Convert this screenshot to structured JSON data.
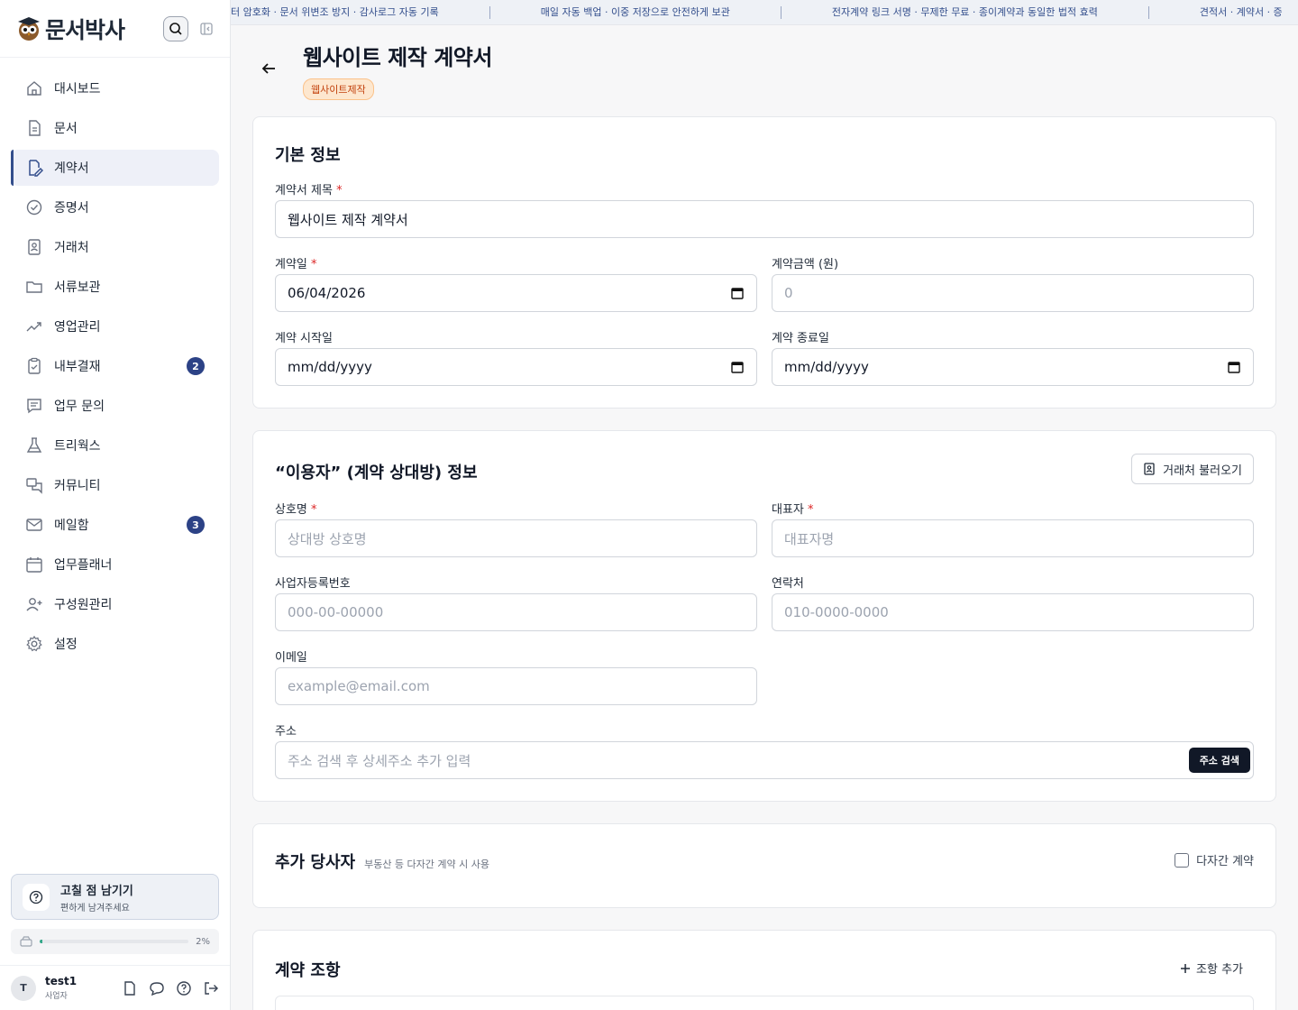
{
  "app": {
    "logo_text": "문서박사"
  },
  "sidebar": {
    "items": [
      {
        "label": "대시보드",
        "icon": "home-icon"
      },
      {
        "label": "문서",
        "icon": "document-icon"
      },
      {
        "label": "계약서",
        "icon": "contract-icon",
        "active": true
      },
      {
        "label": "증명서",
        "icon": "certificate-icon"
      },
      {
        "label": "거래처",
        "icon": "contacts-icon"
      },
      {
        "label": "서류보관",
        "icon": "folder-icon"
      },
      {
        "label": "영업관리",
        "icon": "trend-icon"
      },
      {
        "label": "내부결재",
        "icon": "clipboard-icon",
        "badge": "2"
      },
      {
        "label": "업무 문의",
        "icon": "message-icon"
      },
      {
        "label": "트리웍스",
        "icon": "flask-icon"
      },
      {
        "label": "커뮤니티",
        "icon": "chat-icon"
      },
      {
        "label": "메일함",
        "icon": "mail-icon",
        "badge": "3"
      },
      {
        "label": "업무플래너",
        "icon": "calendar-icon"
      },
      {
        "label": "구성원관리",
        "icon": "user-plus-icon"
      },
      {
        "label": "설정",
        "icon": "gear-icon"
      }
    ],
    "feedback": {
      "title": "고칠 점 남기기",
      "subtitle": "편하게 남겨주세요"
    },
    "storage": {
      "percent_label": "2%",
      "percent": 2
    },
    "user": {
      "initial": "T",
      "name": "test1",
      "role": "사업자"
    }
  },
  "ticker": {
    "items": [
      "터 암호화 · 문서 위변조 방지 · 감사로그 자동 기록",
      "매일 자동 백업 · 이중 저장으로 안전하게 보관",
      "전자계약 링크 서명 · 무제한 무료 · 종이계약과 동일한 법적 효력",
      "견적서 · 계약서 · 증"
    ]
  },
  "page": {
    "title": "웹사이트 제작 계약서",
    "tag": "웹사이트제작"
  },
  "basic": {
    "title": "기본 정보",
    "contract_title_label": "계약서 제목",
    "contract_title_value": "웹사이트 제작 계약서",
    "contract_date_label": "계약일",
    "contract_date_value": "06/04/2026",
    "amount_label": "계약금액 (원)",
    "amount_placeholder": "0",
    "start_label": "계약 시작일",
    "start_placeholder": "mm/dd/yyyy",
    "end_label": "계약 종료일",
    "end_placeholder": "mm/dd/yyyy"
  },
  "party": {
    "title": "“이용자” (계약 상대방) 정보",
    "import_button": "거래처 불러오기",
    "company_label": "상호명",
    "company_placeholder": "상대방 상호명",
    "ceo_label": "대표자",
    "ceo_placeholder": "대표자명",
    "bizno_label": "사업자등록번호",
    "bizno_placeholder": "000-00-00000",
    "phone_label": "연락처",
    "phone_placeholder": "010-0000-0000",
    "email_label": "이메일",
    "email_placeholder": "example@email.com",
    "address_label": "주소",
    "address_placeholder": "주소 검색 후 상세주소 추가 입력",
    "address_button": "주소 검색"
  },
  "extra": {
    "title": "추가 당사자",
    "hint": "부동산 등 다자간 계약 시 사용",
    "checkbox_label": "다자간 계약"
  },
  "clauses": {
    "title": "계약 조항",
    "add_button": "조항 추가"
  },
  "colors": {
    "accent": "#334e8c",
    "badge": "#2c4286",
    "required": "#dc2626",
    "tag_bg": "#fde7cf"
  }
}
